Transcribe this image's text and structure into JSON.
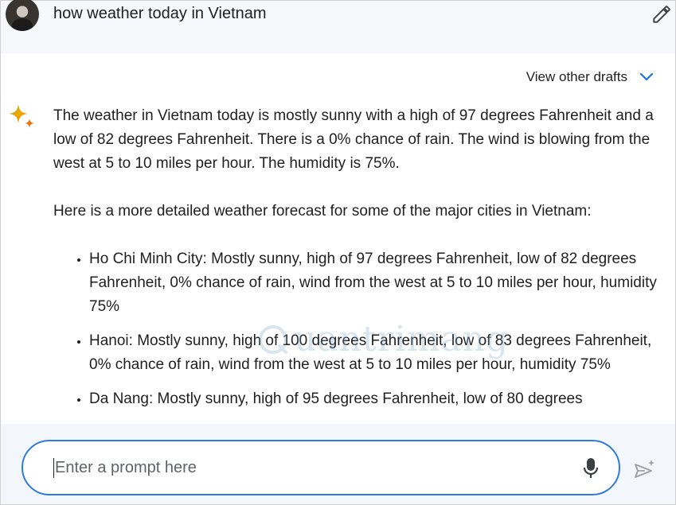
{
  "query": {
    "text": "how weather today in Vietnam"
  },
  "drafts": {
    "label": "View other drafts"
  },
  "response": {
    "paragraphs": [
      "The weather in Vietnam today is mostly sunny with a high of 97 degrees Fahrenheit and a low of 82 degrees Fahrenheit. There is a 0% chance of rain. The wind is blowing from the west at 5 to 10 miles per hour. The humidity is 75%.",
      "Here is a more detailed weather forecast for some of the major cities in Vietnam:"
    ],
    "cities": [
      "Ho Chi Minh City: Mostly sunny, high of 97 degrees Fahrenheit, low of 82 degrees Fahrenheit, 0% chance of rain, wind from the west at 5 to 10 miles per hour, humidity 75%",
      "Hanoi: Mostly sunny, high of 100 degrees Fahrenheit, low of 83 degrees Fahrenheit, 0% chance of rain, wind from the west at 5 to 10 miles per hour, humidity 75%",
      "Da Nang: Mostly sunny, high of 95 degrees Fahrenheit, low of 80 degrees"
    ]
  },
  "watermark": {
    "text": "uantrimang"
  },
  "prompt": {
    "placeholder": "Enter a prompt here",
    "value": ""
  },
  "colors": {
    "accent": "#2f7ae0",
    "header_bg": "#f7f8fb",
    "footer_bg": "#f3f6fb"
  }
}
